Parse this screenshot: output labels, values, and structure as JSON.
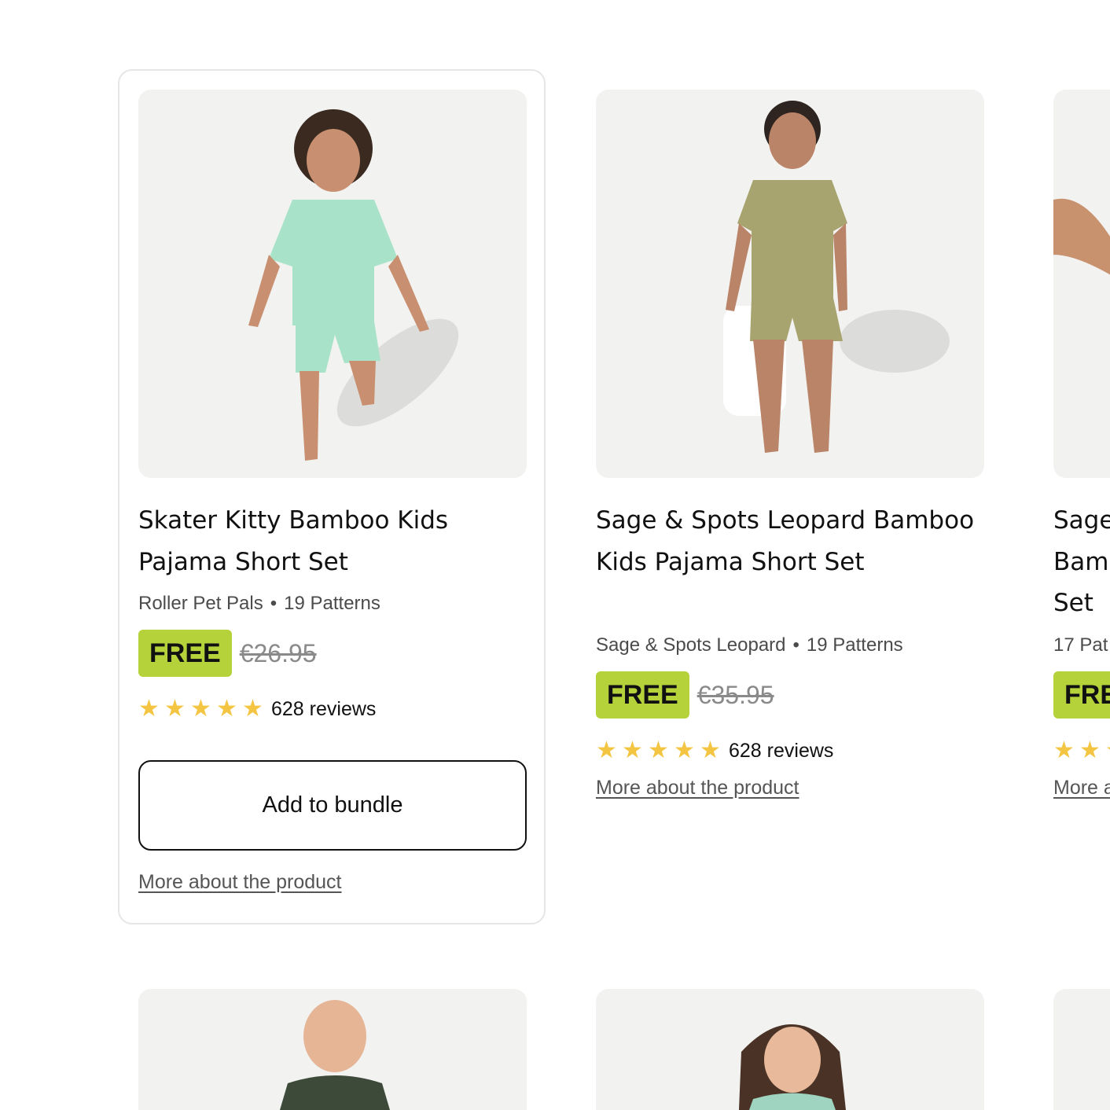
{
  "products": [
    {
      "title": "Skater Kitty Bamboo Kids Pajama Short Set",
      "pattern": "Roller Pet Pals",
      "patterns_count": "19 Patterns",
      "badge": "FREE",
      "old_price": "€26.95",
      "stars": "★★★★★",
      "reviews": "628 reviews",
      "add_button": "Add to bundle",
      "more_link": "More about the product",
      "garment_color": "#a8e3c9",
      "rating": 5
    },
    {
      "title": "Sage & Spots Leopard Bamboo Kids Pajama Short Set",
      "pattern": "Sage & Spots Leopard",
      "patterns_count": "19 Patterns",
      "badge": "FREE",
      "old_price": "€35.95",
      "stars": "★★★★★",
      "reviews": "628 reviews",
      "more_link": "More about the product",
      "garment_color": "#a7a46f",
      "rating": 5
    },
    {
      "title_visible": "Sage Bam Set",
      "patterns_visible": "17 Pat",
      "badge_visible": "FRE",
      "more_visible": "More a"
    }
  ],
  "colors": {
    "badge": "#b5d23a",
    "star": "#f4c542",
    "card_border": "#e6e6e6",
    "image_bg": "#f2f2f1"
  },
  "icons": [
    "star-icon"
  ]
}
